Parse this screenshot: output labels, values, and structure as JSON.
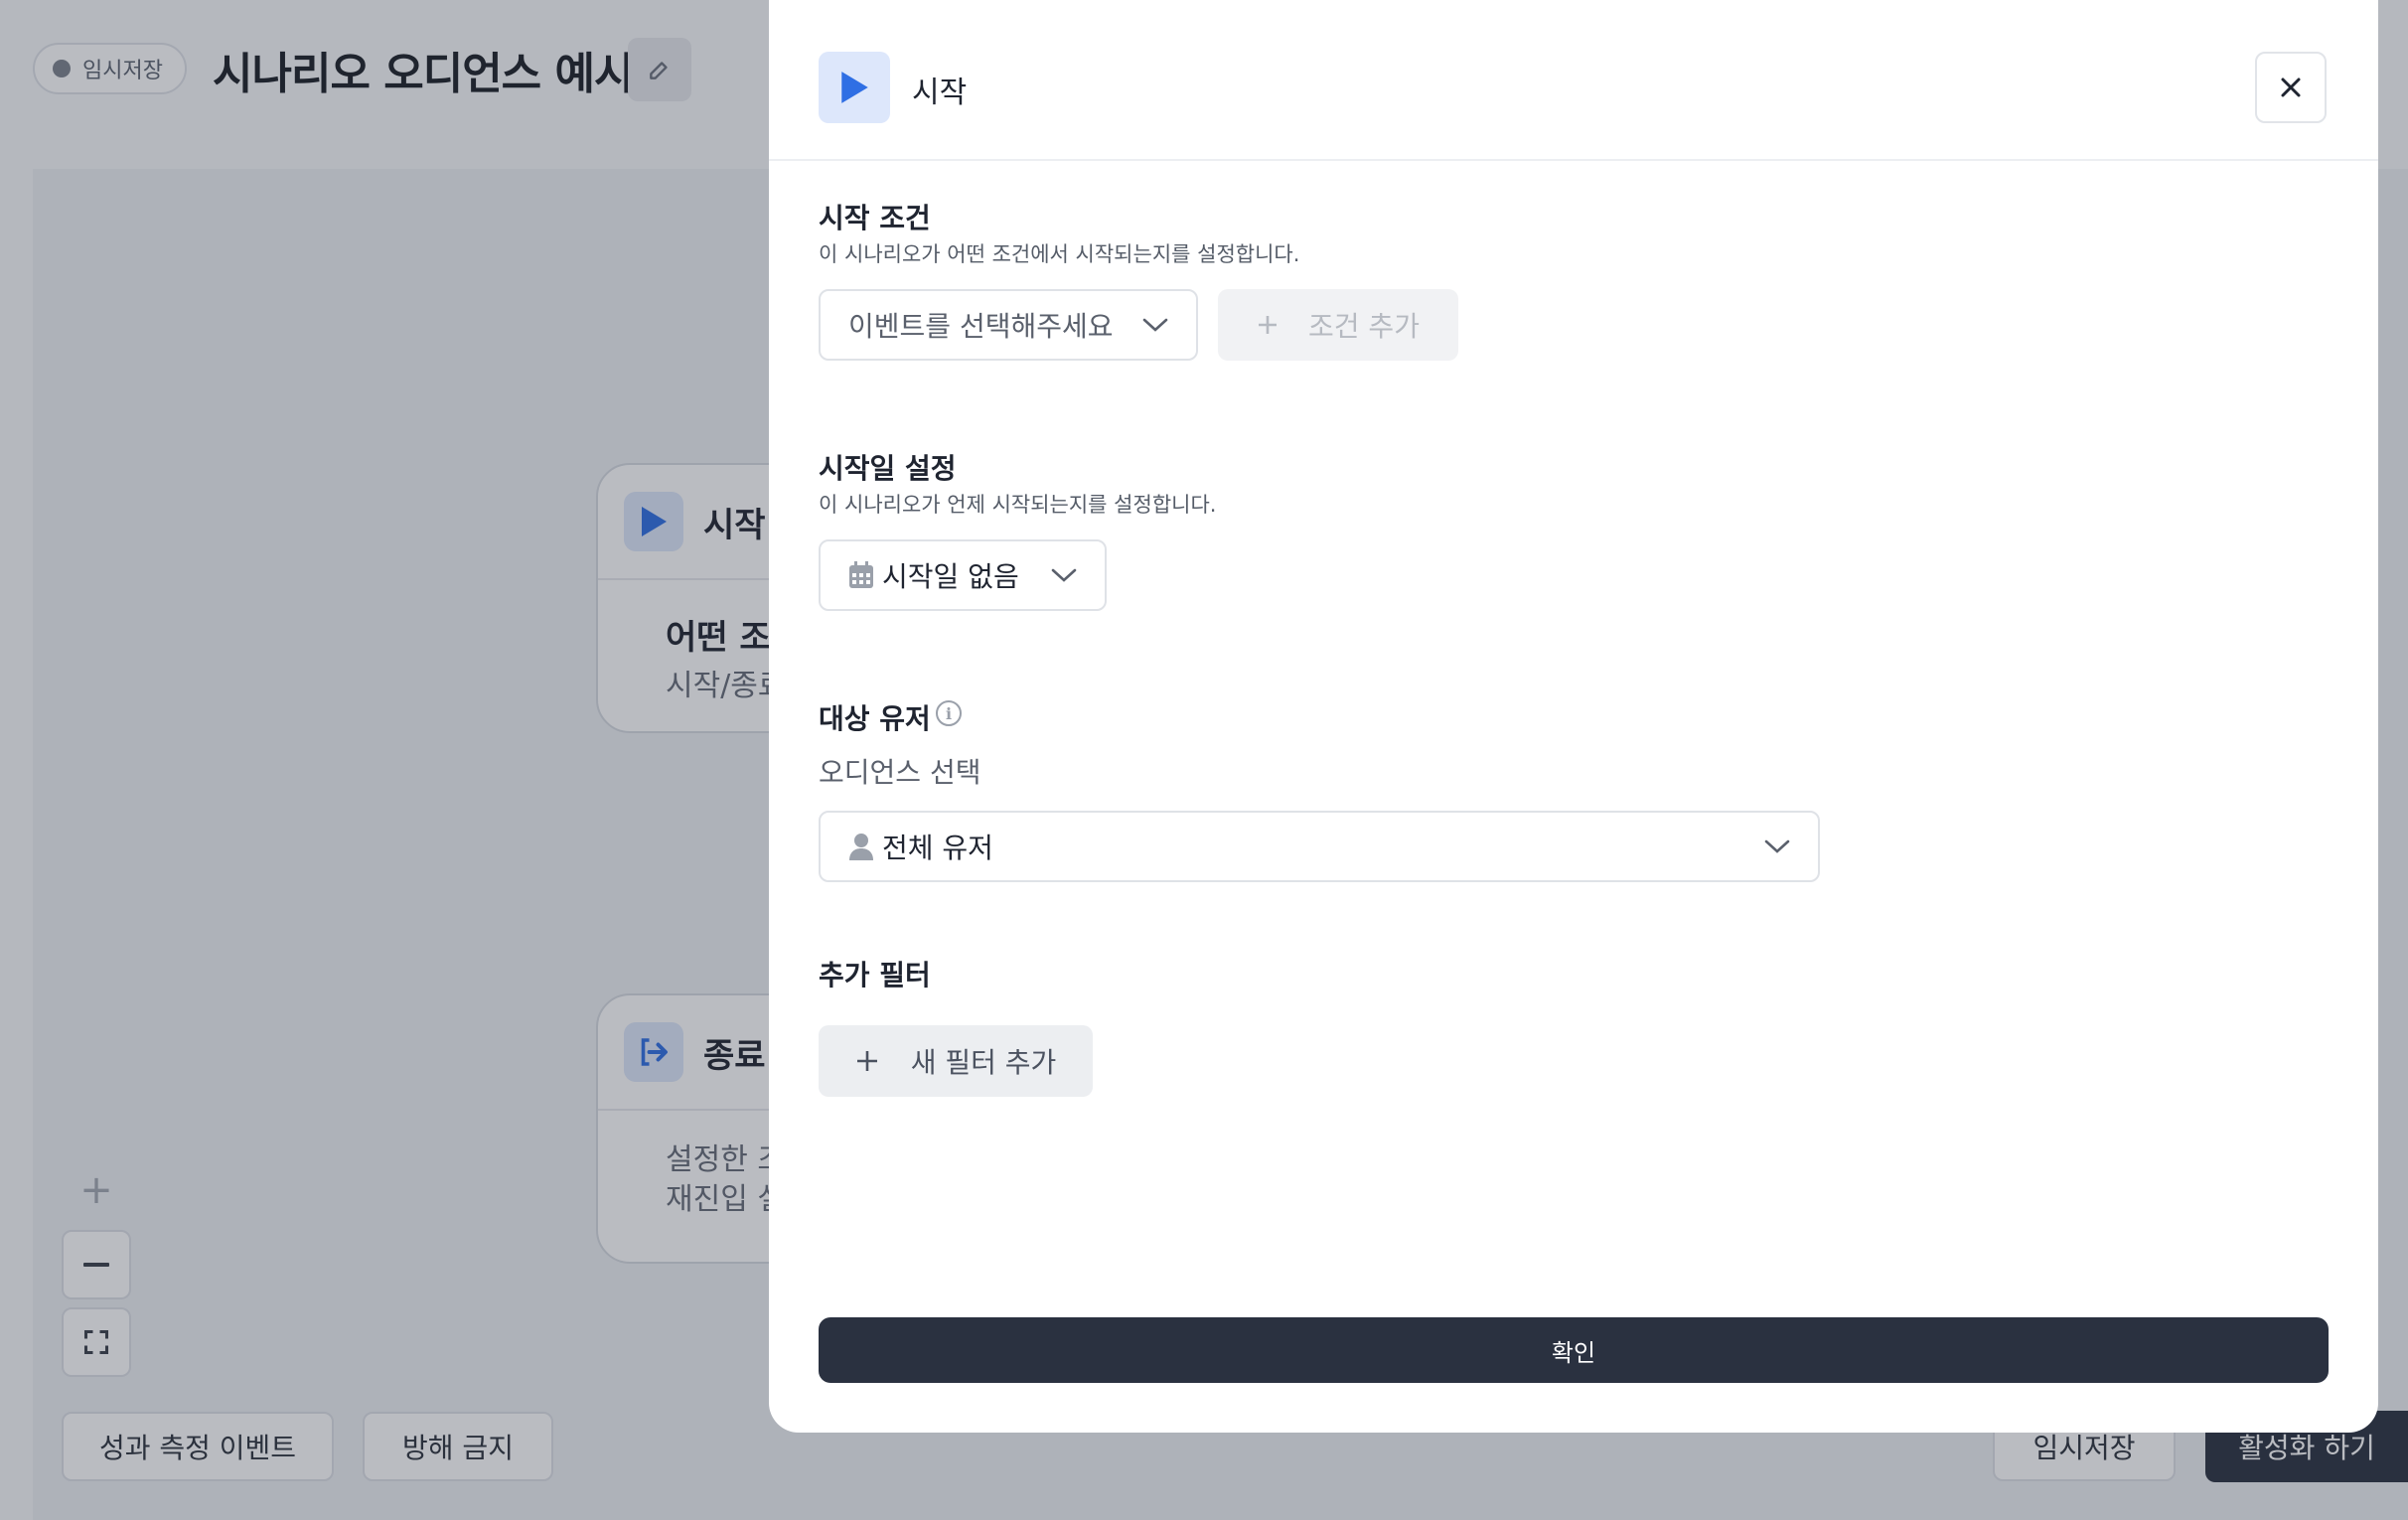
{
  "header": {
    "draft_badge": "임시저장",
    "title": "시나리오 오디언스 예시"
  },
  "canvas": {
    "start_node": {
      "name": "시작",
      "line1": "어떤 조",
      "line2": "시작/종료"
    },
    "end_node": {
      "name": "종료",
      "line1": "설정한 조",
      "line2": "재진입 설"
    },
    "zoom_in_label": "+"
  },
  "footer": {
    "performance_event": "성과 측정 이벤트",
    "do_not_disturb": "방해 금지",
    "save_draft": "임시저장",
    "activate": "활성화 하기"
  },
  "modal": {
    "title": "시작",
    "start_condition": {
      "title": "시작 조건",
      "description": "이 시나리오가 어떤 조건에서 시작되는지를 설정합니다.",
      "event_placeholder": "이벤트를 선택해주세요",
      "add_condition": "조건 추가"
    },
    "start_date": {
      "title": "시작일 설정",
      "description": "이 시나리오가 언제 시작되는지를 설정합니다.",
      "value": "시작일 없음"
    },
    "target_users": {
      "title": "대상 유저",
      "audience_label": "오디언스 선택",
      "audience_value": "전체 유저"
    },
    "extra_filter": {
      "title": "추가 필터",
      "add_filter": "새 필터 추가"
    },
    "confirm": "확인"
  },
  "colors": {
    "accent_blue": "#2f6fe4",
    "dark_button": "#2a3140",
    "icon_bg": "#dde7fb"
  },
  "icons": [
    "play-icon",
    "edit-icon",
    "close-icon",
    "chevron-down-icon",
    "plus-icon",
    "calendar-icon",
    "user-icon",
    "info-icon",
    "exit-icon",
    "minus-icon",
    "fullscreen-icon"
  ]
}
